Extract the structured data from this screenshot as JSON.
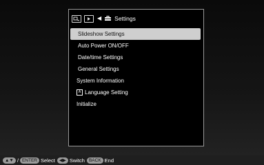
{
  "header": {
    "title": "Settings",
    "tab_icons": [
      "slideshow-icon",
      "playback-icon"
    ],
    "arrow": "◀"
  },
  "menu": {
    "items": [
      {
        "label": "Slideshow Settings",
        "selected": true
      },
      {
        "label": "Auto Power ON/OFF"
      },
      {
        "label": "Date/time Settings"
      },
      {
        "label": "General Settings"
      },
      {
        "label": "System Information"
      },
      {
        "label": "Language Setting",
        "icon": "A"
      },
      {
        "label": "Initialize"
      }
    ]
  },
  "footer": {
    "updown_symbol": "▲▼",
    "slash": "/",
    "enter_key": "ENTER",
    "select_label": "Select",
    "switch_symbol": "◀▶",
    "switch_label": "Switch",
    "back_key": "BACK",
    "end_label": "End"
  },
  "colors": {
    "panel_border": "#9a9a9a",
    "selection_bg": "#cfcfcf",
    "footer_bg": "#1f1f1f",
    "key_pill": "#9a9a9a"
  }
}
